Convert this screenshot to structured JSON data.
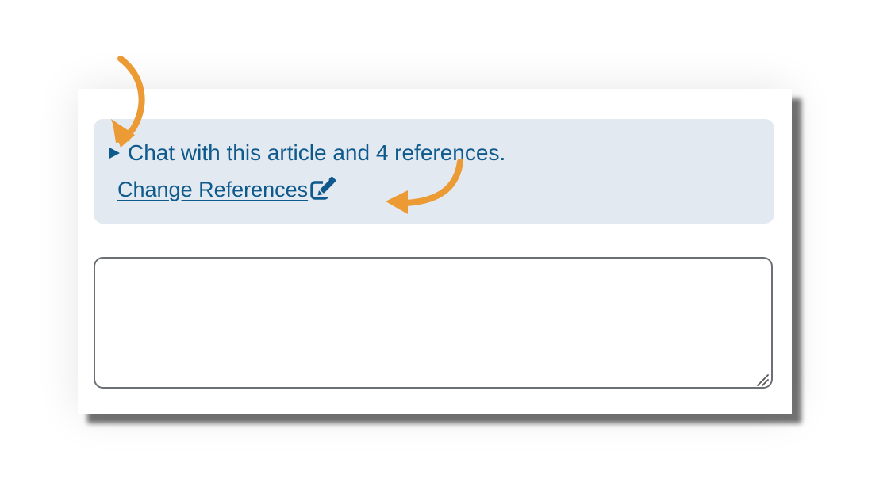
{
  "chat_panel": {
    "summary": "Chat with this article and 4 references.",
    "change_link": "Change References",
    "edit_icon": "pen-to-square-icon",
    "disclosure_icon": "triangle-right-icon",
    "link_color": "#0e5a8c",
    "panel_bg": "#e3e9f1"
  },
  "chat_input": {
    "value": "",
    "placeholder": ""
  },
  "annotations": {
    "arrow_color": "#ec9a34",
    "arrows": [
      "curved-arrow-down-icon",
      "curved-arrow-left-icon"
    ]
  }
}
